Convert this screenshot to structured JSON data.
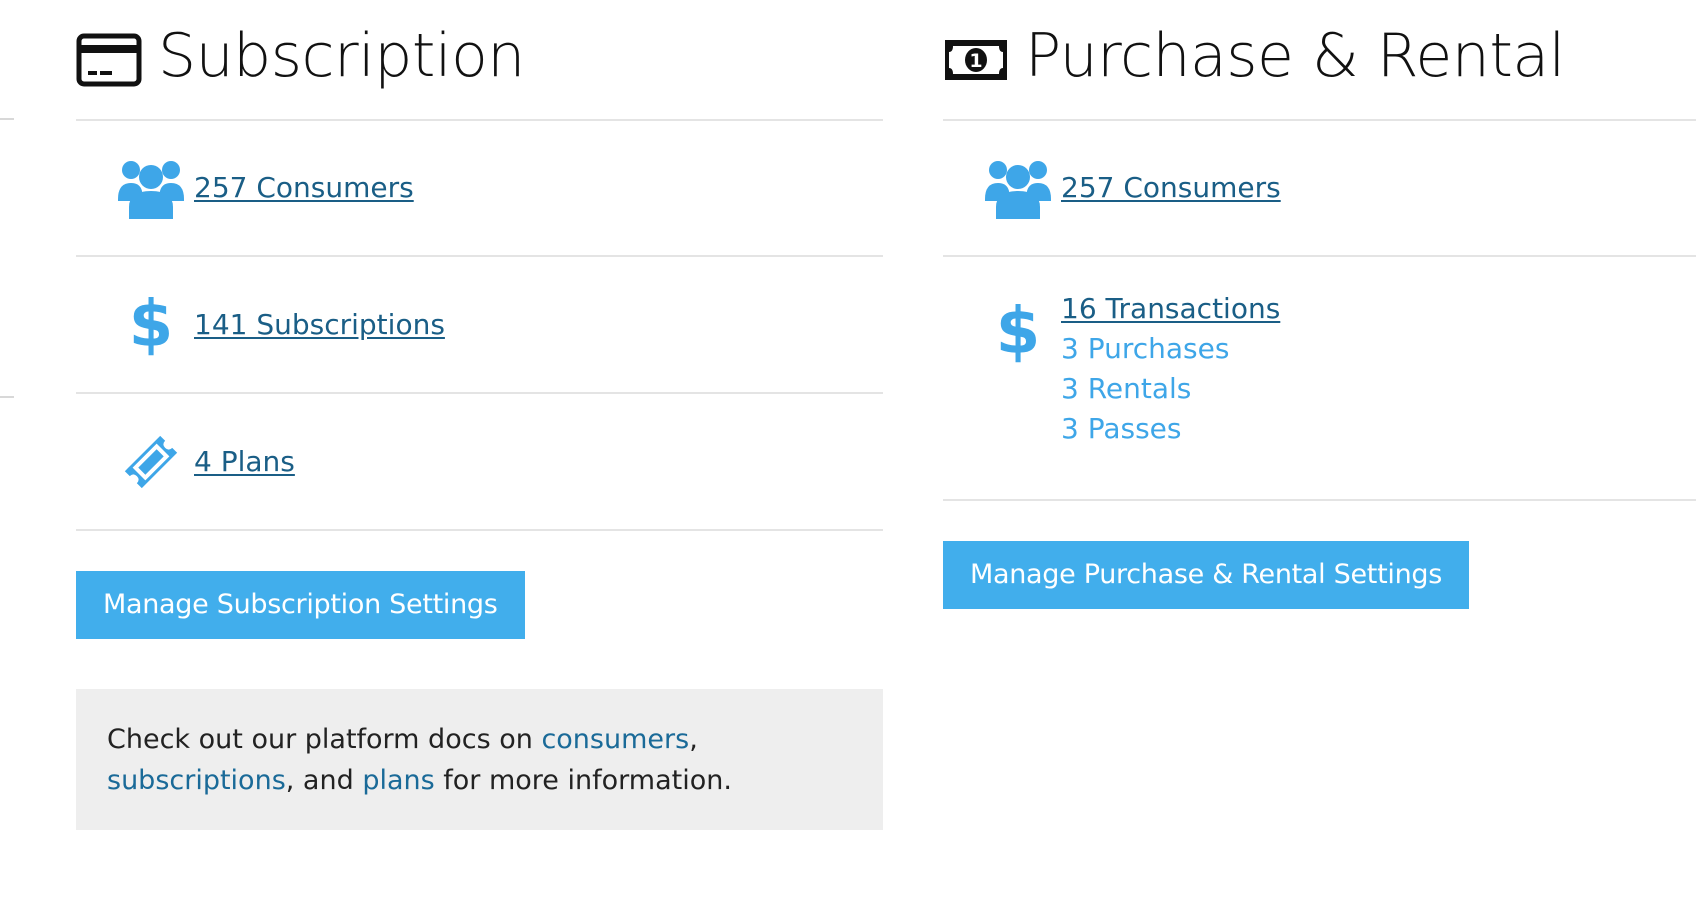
{
  "subscription": {
    "icon": "credit-card-icon",
    "title": "Subscription",
    "consumers_link": "257 Consumers",
    "subscriptions_link": "141 Subscriptions",
    "plans_link": "4 Plans",
    "manage_button": "Manage Subscription Settings",
    "docs": {
      "prefix": "Check out our platform docs on ",
      "consumers_link": "consumers",
      "comma": ",",
      "subscriptions_link": "subscriptions",
      "and": ", and ",
      "plans_link": "plans",
      "suffix": " for more information."
    }
  },
  "purchase_rental": {
    "icon": "money-bill-icon",
    "title": "Purchase & Rental",
    "consumers_link": "257 Consumers",
    "transactions_link": "16 Transactions",
    "purchases": "3 Purchases",
    "rentals": "3 Rentals",
    "passes": "3 Passes",
    "manage_button": "Manage Purchase & Rental Settings"
  },
  "colors": {
    "accent": "#41aeec",
    "icon_blue": "#3ea6e8",
    "link": "#1a5e86",
    "divider": "#e4e4e4",
    "docs_bg": "#eeeeee"
  }
}
